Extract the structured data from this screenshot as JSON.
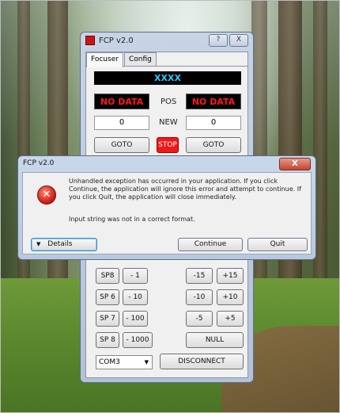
{
  "window": {
    "title": "FCP v2.0",
    "help_btn": "?",
    "close_btn": "X",
    "tabs": [
      {
        "label": "Focuser",
        "active": true
      },
      {
        "label": "Config",
        "active": false
      }
    ],
    "display_top": "XXXX",
    "left_lcd": "NO DATA",
    "right_lcd": "NO DATA",
    "pos_label": "POS",
    "new_label": "NEW",
    "left_value": "0",
    "right_value": "0",
    "goto_left": "GOTO",
    "stop": "STOP",
    "goto_right": "GOTO",
    "sp_buttons": [
      "SP8",
      "SP 6",
      "SP 7",
      "SP 8"
    ],
    "minus_buttons": [
      "- 1",
      "- 10",
      "- 100",
      "- 1000"
    ],
    "neg_buttons": [
      "-15",
      "-10",
      "-5"
    ],
    "pos_buttons": [
      "+15",
      "+10",
      "+5"
    ],
    "null_btn": "NULL",
    "port": "COM3",
    "disconnect": "DISCONNECT"
  },
  "dialog": {
    "title": "FCP v2.0",
    "close_btn": "X",
    "message": "Unhandled exception has occurred in your application. If you click Continue, the application will ignore this error and attempt to continue. If you click Quit, the application will close immediately.",
    "detail": "Input string was not in a correct format.",
    "details_btn": "Details",
    "continue_btn": "Continue",
    "quit_btn": "Quit"
  }
}
